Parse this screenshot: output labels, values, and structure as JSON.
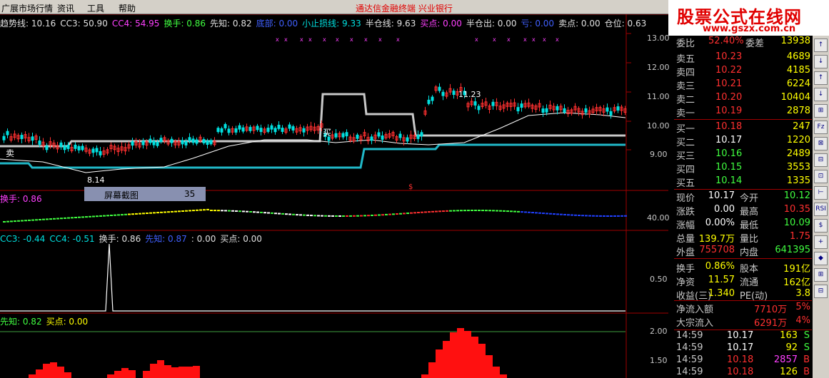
{
  "menu": {
    "items": [
      "广展市场行情",
      "资讯",
      "工具",
      "帮助"
    ],
    "center": "通达信金融终端  兴业银行"
  },
  "logo": {
    "title": "股票公式在线网",
    "url": "www.gszx.com.cn"
  },
  "main_indicator": [
    {
      "text": "趋势线: 10.16",
      "cls": "w"
    },
    {
      "text": "CC3: 50.90",
      "cls": "w"
    },
    {
      "text": "CC4: 54.95",
      "cls": "m"
    },
    {
      "text": "换手: 0.86",
      "cls": "g"
    },
    {
      "text": "先知: 0.82",
      "cls": "w"
    },
    {
      "text": "底部: 0.00",
      "cls": "b"
    },
    {
      "text": "小止损线: 9.33",
      "cls": "c"
    },
    {
      "text": "半仓线: 9.63",
      "cls": "w"
    },
    {
      "text": "买点: 0.00",
      "cls": "m"
    },
    {
      "text": "半仓出: 0.00",
      "cls": "w"
    },
    {
      "text": "亏: 0.00",
      "cls": "b"
    },
    {
      "text": "卖点: 0.00",
      "cls": "w"
    },
    {
      "text": "仓位: 0.63",
      "cls": "w"
    }
  ],
  "main_axis": [
    "13.00",
    "12.00",
    "11.00",
    "10.00",
    "9.00"
  ],
  "annotations": {
    "high": "11.23",
    "low": "8.14",
    "buy": "买",
    "sell": "卖"
  },
  "panel2": {
    "title": "换手: 0.86",
    "axis": "40.00",
    "screenshot_label": "屏幕截图",
    "screenshot_num": "35"
  },
  "panel3": {
    "items": [
      {
        "text": "CC3: -0.44",
        "cls": "c"
      },
      {
        "text": "CC4: -0.51",
        "cls": "c"
      },
      {
        "text": "换手: 0.86",
        "cls": "w"
      },
      {
        "text": "先知: 0.87",
        "cls": "b"
      },
      {
        "text": ": 0.00",
        "cls": "w"
      },
      {
        "text": "买点: 0.00",
        "cls": "w"
      }
    ],
    "axis": "0.50"
  },
  "panel4": {
    "items": [
      {
        "text": "先知: 0.82",
        "cls": "g"
      },
      {
        "text": "买点: 0.00",
        "cls": "y"
      }
    ],
    "axis": [
      "2.00",
      "1.50"
    ]
  },
  "quote": {
    "top_label": "委比",
    "top_value": "52.40%",
    "top_label2": "委差",
    "top_value2": "13938",
    "asks": [
      {
        "label": "卖五",
        "price": "10.23",
        "vol": "4689"
      },
      {
        "label": "卖四",
        "price": "10.22",
        "vol": "4185"
      },
      {
        "label": "卖三",
        "price": "10.21",
        "vol": "6224"
      },
      {
        "label": "卖二",
        "price": "10.20",
        "vol": "10404"
      },
      {
        "label": "卖一",
        "price": "10.19",
        "vol": "2878"
      }
    ],
    "bids": [
      {
        "label": "买一",
        "price": "10.18",
        "vol": "247"
      },
      {
        "label": "买二",
        "price": "10.17",
        "vol": "1220"
      },
      {
        "label": "买三",
        "price": "10.16",
        "vol": "2489"
      },
      {
        "label": "买四",
        "price": "10.15",
        "vol": "3553"
      },
      {
        "label": "买五",
        "price": "10.14",
        "vol": "1335"
      }
    ],
    "stats": [
      {
        "l1": "现价",
        "v1": "10.17",
        "c1": "#ffffff",
        "l2": "今开",
        "v2": "10.12",
        "c2": "#40ff40"
      },
      {
        "l1": "涨跌",
        "v1": "0.00",
        "c1": "#ffffff",
        "l2": "最高",
        "v2": "10.35",
        "c2": "#ff3030"
      },
      {
        "l1": "涨幅",
        "v1": "0.00%",
        "c1": "#ffffff",
        "l2": "最低",
        "v2": "10.09",
        "c2": "#40ff40"
      },
      {
        "l1": "总量",
        "v1": "139.7万",
        "c1": "#ffff00",
        "l2": "量比",
        "v2": "1.75",
        "c2": "#ff3030"
      },
      {
        "l1": "外盘",
        "v1": "755708",
        "c1": "#ff3030",
        "l2": "内盘",
        "v2": "641395",
        "c2": "#40ff40"
      },
      {
        "l1": "换手",
        "v1": "0.86%",
        "c1": "#ffff00",
        "l2": "股本",
        "v2": "191亿",
        "c2": "#ffff00"
      },
      {
        "l1": "净资",
        "v1": "11.57",
        "c1": "#ffff00",
        "l2": "流通",
        "v2": "162亿",
        "c2": "#ffff00"
      },
      {
        "l1": "收益(三)",
        "v1": "1.340",
        "c1": "#ffff00",
        "l2": "PE(动)",
        "v2": "3.8",
        "c2": "#ffff00"
      }
    ],
    "flow": [
      {
        "label": "净流入额",
        "value": "7710万",
        "pct": "5%"
      },
      {
        "label": "大宗流入",
        "value": "6291万",
        "pct": "4%"
      }
    ],
    "ticks": [
      {
        "time": "14:59",
        "price": "10.17",
        "vol": "163",
        "side": "S",
        "vc": "#ffff00",
        "sc": "#40ff40"
      },
      {
        "time": "14:59",
        "price": "10.17",
        "vol": "92",
        "side": "S",
        "vc": "#ffff00",
        "sc": "#40ff40"
      },
      {
        "time": "14:59",
        "price": "10.18",
        "vol": "2857",
        "side": "B",
        "vc": "#ff40ff",
        "sc": "#ff3030"
      },
      {
        "time": "14:59",
        "price": "10.18",
        "vol": "126",
        "side": "B",
        "vc": "#ffff00",
        "sc": "#ff3030"
      }
    ]
  },
  "tools": [
    "↑",
    "↓",
    "↑",
    "↓",
    "⊞",
    "Fz",
    "⊠",
    "⊟",
    "⊡",
    "⊢",
    "RSI",
    "$",
    "+",
    "◆",
    "⊞",
    "⊟"
  ],
  "colors": {
    "up": "#ff3030",
    "down": "#00e0e0",
    "trend": "#ffffff",
    "stop": "#20c0d0",
    "half": "#c8c8c8"
  }
}
